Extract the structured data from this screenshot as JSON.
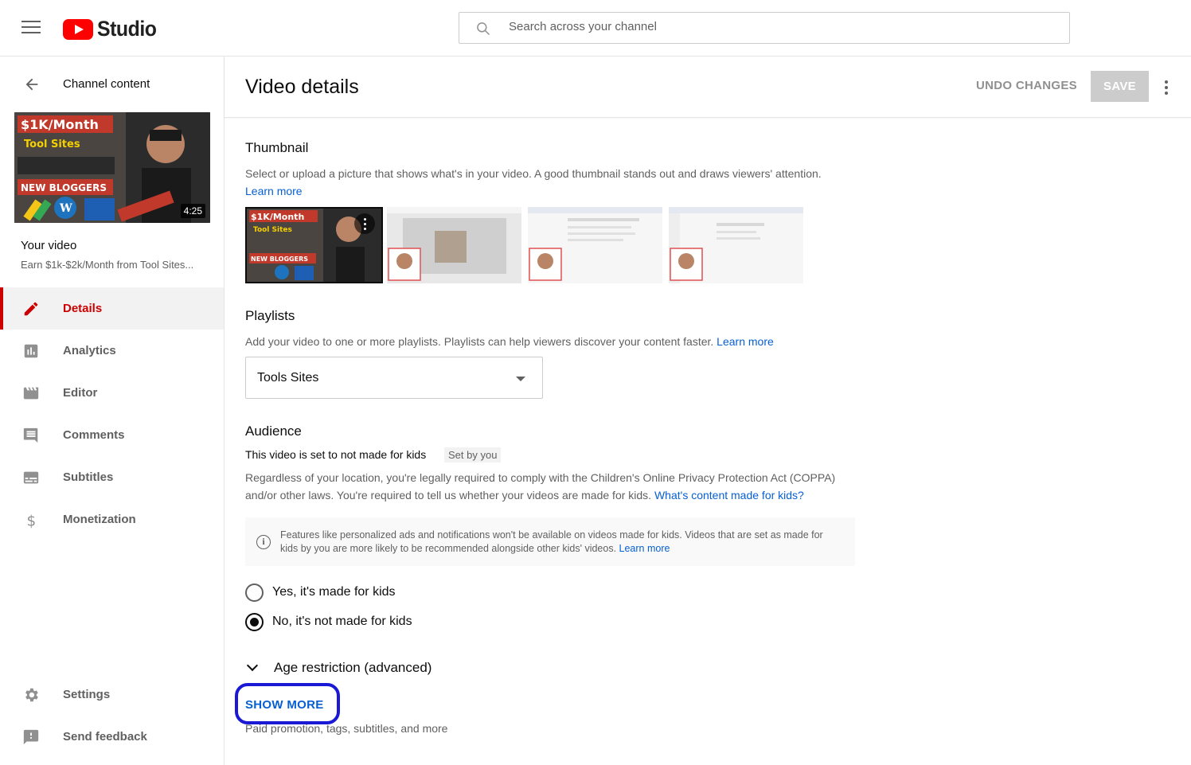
{
  "topbar": {
    "logo_text": "Studio",
    "search_placeholder": "Search across your channel"
  },
  "sidebar": {
    "back_label": "Channel content",
    "thumbnail_duration": "4:25",
    "your_video_label": "Your video",
    "video_title": "Earn $1k-$2k/Month from Tool Sites...",
    "nav": [
      {
        "label": "Details",
        "icon": "pencil-icon",
        "active": true
      },
      {
        "label": "Analytics",
        "icon": "analytics-icon",
        "active": false
      },
      {
        "label": "Editor",
        "icon": "clapperboard-icon",
        "active": false
      },
      {
        "label": "Comments",
        "icon": "comment-icon",
        "active": false
      },
      {
        "label": "Subtitles",
        "icon": "subtitles-icon",
        "active": false
      },
      {
        "label": "Monetization",
        "icon": "dollar-icon",
        "active": false
      }
    ],
    "bottom_nav": [
      {
        "label": "Settings",
        "icon": "gear-icon"
      },
      {
        "label": "Send feedback",
        "icon": "feedback-icon"
      }
    ]
  },
  "header": {
    "title": "Video details",
    "undo_label": "UNDO CHANGES",
    "save_label": "SAVE"
  },
  "thumbnail": {
    "title": "Thumbnail",
    "description": "Select or upload a picture that shows what's in your video. A good thumbnail stands out and draws viewers' attention.",
    "learn_more": "Learn more"
  },
  "playlists": {
    "title": "Playlists",
    "description": "Add your video to one or more playlists. Playlists can help viewers discover your content faster.",
    "learn_more": "Learn more",
    "selected": "Tools Sites"
  },
  "audience": {
    "title": "Audience",
    "status": "This video is set to not made for kids",
    "set_by": "Set by you",
    "description": "Regardless of your location, you're legally required to comply with the Children's Online Privacy Protection Act (COPPA) and/or other laws. You're required to tell us whether your videos are made for kids.",
    "link": "What's content made for kids?",
    "info_text": "Features like personalized ads and notifications won't be available on videos made for kids. Videos that are set as made for kids by you are more likely to be recommended alongside other kids' videos.",
    "info_link": "Learn more",
    "option_yes": "Yes, it's made for kids",
    "option_no": "No, it's not made for kids",
    "selected": "no"
  },
  "age_restriction": {
    "label": "Age restriction (advanced)"
  },
  "show_more": {
    "label": "SHOW MORE",
    "subtitle": "Paid promotion, tags, subtitles, and more"
  },
  "colors": {
    "accent_red": "#cc0000",
    "link_blue": "#065fd4",
    "annotation_blue": "#1a1ad6"
  }
}
